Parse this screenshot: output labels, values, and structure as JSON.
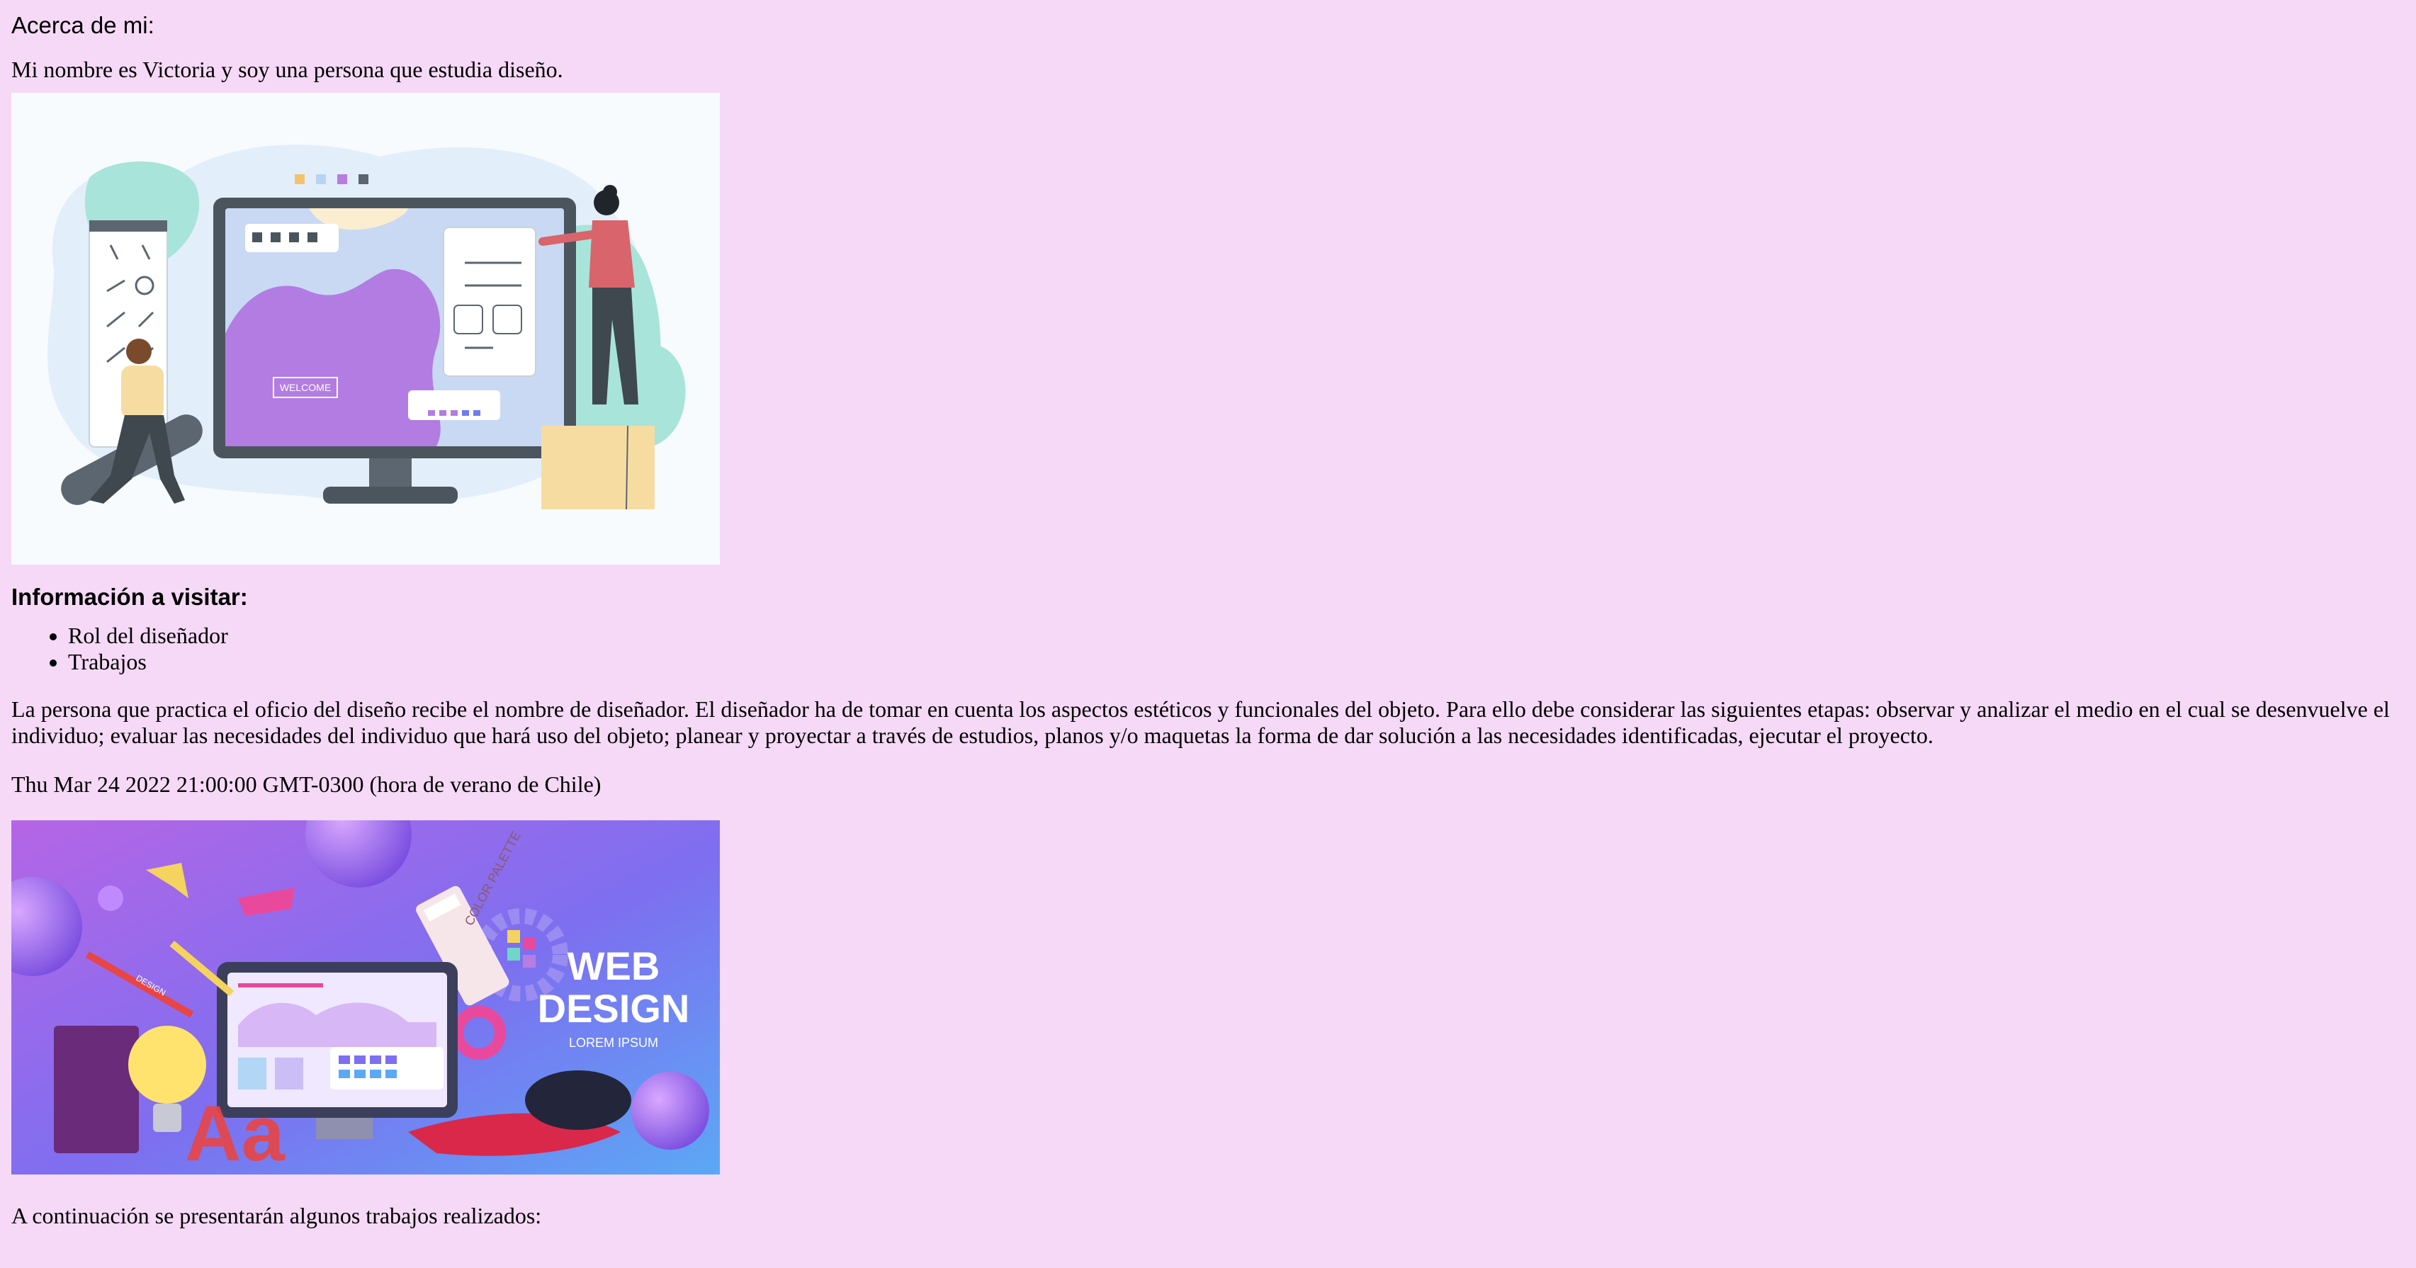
{
  "about": {
    "title": "Acerca de mi:",
    "intro": "Mi nombre es Victoria y soy una persona que estudia diseño."
  },
  "illustration_top": {
    "icon": "designer-working-illustration",
    "screen_label": "WELCOME"
  },
  "visit": {
    "title": "Información a visitar:",
    "items": [
      {
        "label": "Rol del diseñador"
      },
      {
        "label": "Trabajos"
      }
    ]
  },
  "description": "La persona que practica el oficio del diseño recibe el nombre de diseñador. El diseñador ha de tomar en cuenta los aspectos estéticos y funcionales del objeto. Para ello debe considerar las siguientes etapas: observar y analizar el medio en el cual se desenvuelve el individuo; evaluar las necesidades del individuo que hará uso del objeto; planear y proyectar a través de estudios, planos y/o maquetas la forma de dar solución a las necesidades identificadas, ejecutar el proyecto.",
  "date_text": "Thu Mar 24 2022 21:00:00 GMT-0300 (hora de verano de Chile)",
  "banner": {
    "icon": "web-design-banner-illustration",
    "title_line1": "WEB",
    "title_line2": "DESIGN",
    "subtitle": "LOREM IPSUM",
    "palette_label": "COLOR PALETTE",
    "design_label": "DESIGN",
    "letters": "Aa"
  },
  "continuation": "A continuación se presentarán algunos trabajos realizados:",
  "colors": {
    "background": "#f5d9f6",
    "purple": "#a66ee0",
    "blue": "#6f7cf0"
  }
}
